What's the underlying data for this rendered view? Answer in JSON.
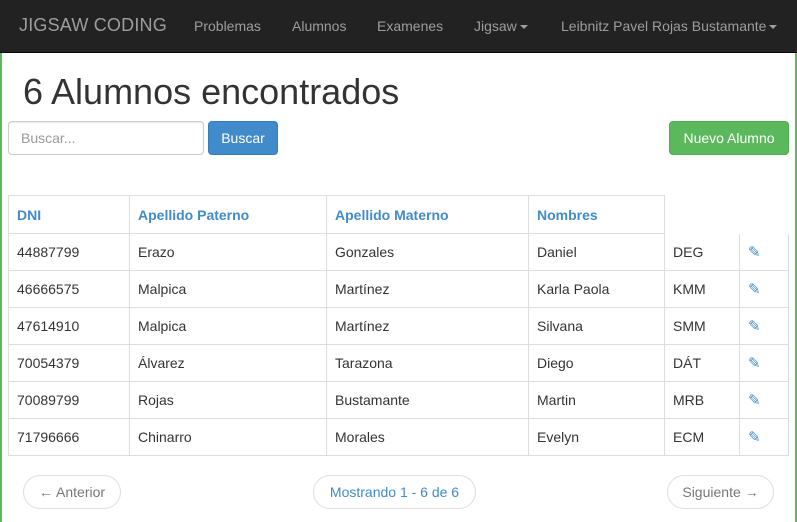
{
  "navbar": {
    "brand": "JIGSAW CODING",
    "items": [
      "Problemas",
      "Alumnos",
      "Examenes",
      "Jigsaw"
    ],
    "user": "Leibnitz Pavel Rojas Bustamante"
  },
  "page": {
    "title": "6 Alumnos encontrados"
  },
  "search": {
    "placeholder": "Buscar...",
    "button": "Buscar"
  },
  "new_button": "Nuevo Alumno",
  "table": {
    "headers": [
      "DNI",
      "Apellido Paterno",
      "Apellido Materno",
      "Nombres"
    ],
    "rows": [
      {
        "dni": "44887799",
        "paterno": "Erazo",
        "materno": "Gonzales",
        "nombres": "Daniel",
        "iniciales": "DEG"
      },
      {
        "dni": "46666575",
        "paterno": "Malpica",
        "materno": "Martínez",
        "nombres": "Karla Paola",
        "iniciales": "KMM"
      },
      {
        "dni": "47614910",
        "paterno": "Malpica",
        "materno": "Martínez",
        "nombres": "Silvana",
        "iniciales": "SMM"
      },
      {
        "dni": "70054379",
        "paterno": "Álvarez",
        "materno": "Tarazona",
        "nombres": "Diego",
        "iniciales": "DÁT"
      },
      {
        "dni": "70089799",
        "paterno": "Rojas",
        "materno": "Bustamante",
        "nombres": "Martin",
        "iniciales": "MRB"
      },
      {
        "dni": "71796666",
        "paterno": "Chinarro",
        "materno": "Morales",
        "nombres": "Evelyn",
        "iniciales": "ECM"
      }
    ],
    "edit_icon": "pencil-icon"
  },
  "pagination": {
    "prev": "← Anterior",
    "info": "Mostrando 1 - 6 de 6",
    "next": "Siguiente →"
  },
  "colors": {
    "navbar_bg": "#222222",
    "primary": "#428bca",
    "success": "#5cb85c"
  }
}
